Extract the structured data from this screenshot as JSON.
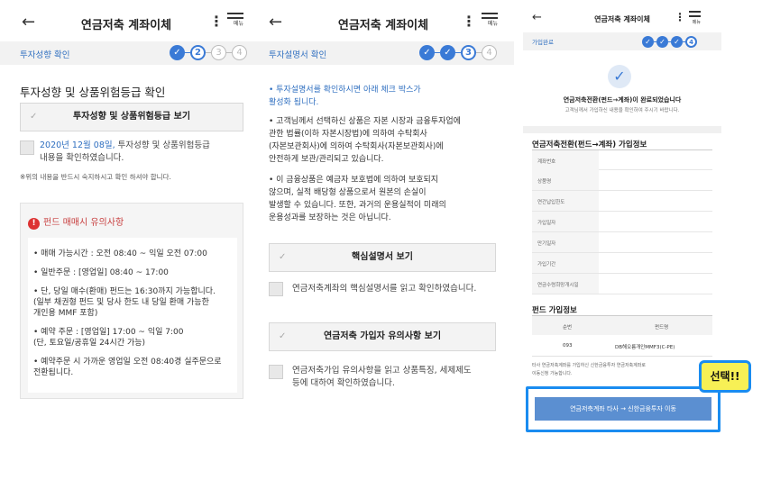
{
  "panel1": {
    "title": "연금저축 계좌이체",
    "menu_label": "메뉴",
    "step_label": "투자성향 확인",
    "steps": [
      "1",
      "2",
      "3",
      "4"
    ],
    "section_title": "투자성향 및 상품위험등급 확인",
    "view_button": "투자성향 및 상품위험등급 보기",
    "confirm_date": "2020년 12월 08일,",
    "confirm_text1": " 투자성향 및 상품위험등급",
    "confirm_text2": "내용을 확인하였습니다.",
    "note": "※위의 내용을 반드시 숙지하시고 확인 하셔야 합니다.",
    "notice_title": "펀드 매매시 유의사항",
    "notice_items": [
      "• 매매 가능시간 : 오전 08:40 ~ 익일 오전 07:00",
      "• 일반주문 : [영업일] 08:40 ~ 17:00",
      "• 단, 당일 매수(환매) 펀드는 16:30까지 가능합니다.",
      "  (일부 채권형 펀드 및 당사 한도 내 당일 환매 가능한",
      "  개인용 MMF 포함)",
      "• 예약 주문 : [영업일] 17:00 ~ 익일 7:00",
      "  (단, 토요일/공휴일 24시간 가능)",
      "• 예약주문 시 가까운 영업일 오전 08:40경 실주문으로",
      "  전환됩니다."
    ]
  },
  "panel2": {
    "title": "연금저축 계좌이체",
    "menu_label": "메뉴",
    "step_label": "투자설명서 확인",
    "steps": [
      "1",
      "2",
      "3",
      "4"
    ],
    "bullet1a": "• 투자설명서를 확인하시면 아래 체크 박스가",
    "bullet1b": "  활성화 됩니다.",
    "bullet2": [
      "• 고객님께서 선택하신 상품은 자본 시장과 금융투자업에",
      "  관한 법률(이하 자본시장법)에 의하여 수탁회사",
      "  (자본보관회사)에 의하여 수탁회사(자본보관회사)에",
      "  안전하게 보관/관리되고 있습니다."
    ],
    "bullet3": [
      "• 이 금융상품은 예금자 보호법에 의하여 보호되지",
      "  않으며, 실적 배당형 상품으로서 원본의 손실이",
      "  발생할 수 있습니다. 또한, 과거의 운용실적이 미래의",
      "  운용성과를 보장하는 것은 아닙니다."
    ],
    "btn_prospectus": "핵심설명서 보기",
    "check_prospectus": "연금저축계좌의 핵심설명서를 읽고 확인하였습니다.",
    "btn_caution": "연금저축 가입자 유의사항 보기",
    "check_caution1": "연금저축가입 유의사항을 읽고 상품특징, 세제제도",
    "check_caution2": "등에 대하여 확인하였습니다."
  },
  "panel3": {
    "title": "연금저축 계좌이체",
    "menu_label": "메뉴",
    "step_label": "가입완료",
    "steps": [
      "1",
      "2",
      "3",
      "4"
    ],
    "done_title": "연금저축전환(펀드→계좌)이 완료되었습니다",
    "done_sub": "고객님께서 가입하신 내용을 확인하여 주시기 바랍니다.",
    "info_title": "연금저축전환(펀드→계좌) 가입정보",
    "info_rows": [
      "계좌번호",
      "상품명",
      "연간납입한도",
      "가입일자",
      "만기일자",
      "가입기간",
      "연금수령희망개시일"
    ],
    "fund_title": "펀드 가입정보",
    "fund_headers": [
      "순번",
      "펀드명"
    ],
    "fund_row": [
      "093",
      "DB해오름개인MMF3(C-PE)"
    ],
    "note1": "타사 연금저축계좌를 가입하신 신한금융투자 연금저축계좌로",
    "note2": "이동신청 가능합니다.",
    "transfer_btn": "연금저축계좌 타사 → 신한금융투자 이동",
    "callout": "선택!!"
  },
  "colors": {
    "accent": "#3a7ad6",
    "highlight": "#1a8cf0",
    "callout": "#f7f055"
  }
}
